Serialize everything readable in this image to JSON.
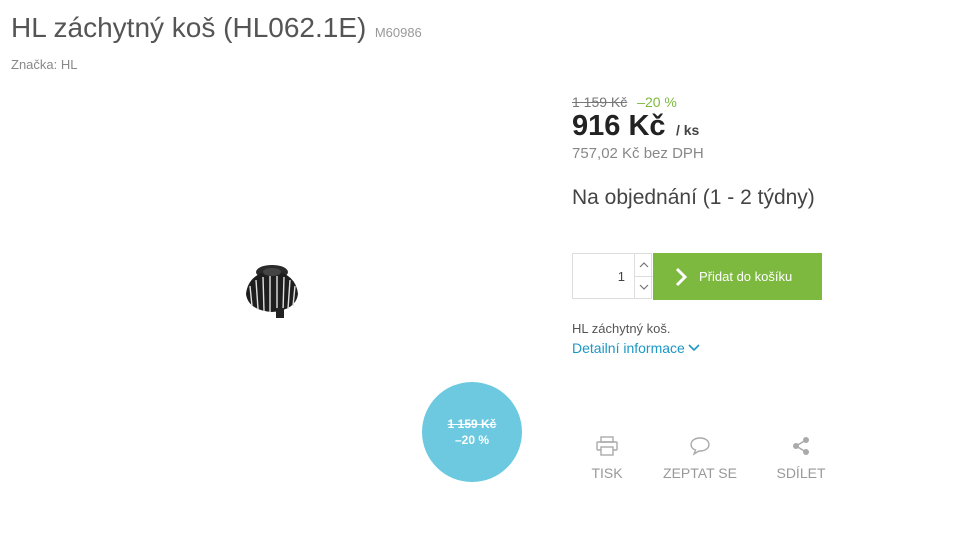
{
  "product": {
    "title": "HL záchytný koš (HL062.1E)",
    "code": "M60986",
    "brand_label": "Značka:",
    "brand_value": "HL"
  },
  "pricing": {
    "old_price": "1 159 Kč",
    "discount": "–20 %",
    "price": "916 Kč",
    "unit": "/ ks",
    "price_without_vat": "757,02 Kč bez DPH"
  },
  "badge": {
    "old_price": "1 159 Kč",
    "discount": "–20 %"
  },
  "availability": "Na objednání (1 - 2 týdny)",
  "cart": {
    "quantity": "1",
    "add_label": "Přidat do košíku"
  },
  "description": {
    "short": "HL záchytný koš.",
    "detail_link": "Detailní informace"
  },
  "actions": {
    "print": "TISK",
    "ask": "ZEPTAT SE",
    "share": "SDÍLET"
  },
  "colors": {
    "accent_green": "#7cb93e",
    "badge_blue": "#6cc9e0",
    "link_blue": "#1d97c6"
  }
}
